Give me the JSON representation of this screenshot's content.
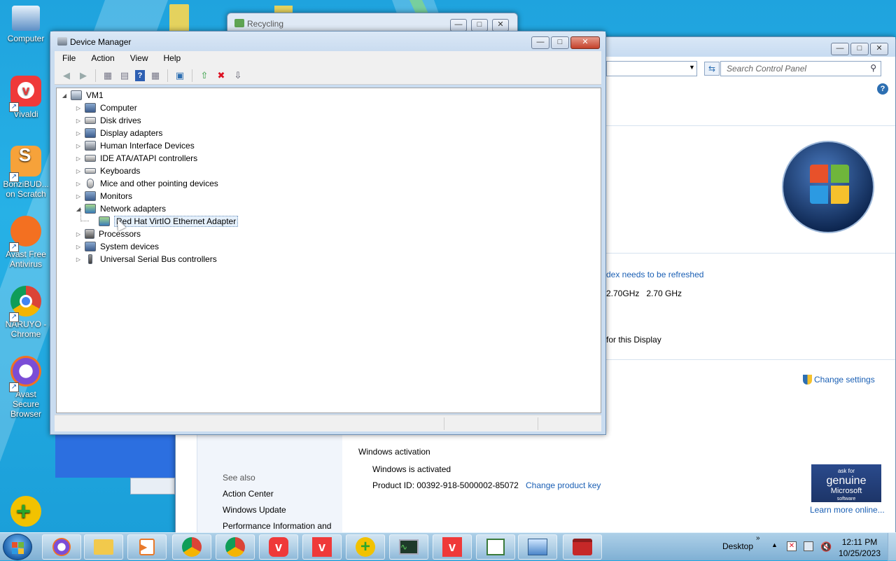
{
  "desktop": {
    "icons": [
      {
        "label": "Computer",
        "icon": "computer-icon"
      },
      {
        "label": "Vivaldi",
        "icon": "vivaldi-icon"
      },
      {
        "label": "BonziBUD... on Scratch",
        "icon": "scratch-icon"
      },
      {
        "label": "Avast Free Antivirus",
        "icon": "avast-icon"
      },
      {
        "label": "NARUYO - Chrome",
        "icon": "chrome-icon"
      },
      {
        "label": "Avast Secure Browser",
        "icon": "avast-secure-browser-icon"
      }
    ]
  },
  "recycling": {
    "title": "Recycling"
  },
  "control_panel": {
    "search_placeholder": "Search Control Panel",
    "index_text": "dex needs to be refreshed",
    "processor_text": "2.70GHz   2.70 GHz",
    "display_text": "for this Display",
    "change_settings": "Change settings",
    "activation_heading": "Windows activation",
    "activated": "Windows is activated",
    "product_id_label": "Product ID: 00392-918-5000002-85072",
    "change_key": "Change product key",
    "genuine_line1": "ask for",
    "genuine_line2": "genuine",
    "genuine_line3": "Microsoft",
    "genuine_line4": "software",
    "learn_more": "Learn more online...",
    "see_also": "See also",
    "see_also_links": [
      "Action Center",
      "Windows Update",
      "Performance Information and"
    ]
  },
  "device_manager": {
    "title": "Device Manager",
    "menu": [
      "File",
      "Action",
      "View",
      "Help"
    ],
    "root": "VM1",
    "categories": [
      {
        "label": "Computer",
        "expanded": false
      },
      {
        "label": "Disk drives",
        "expanded": false
      },
      {
        "label": "Display adapters",
        "expanded": false
      },
      {
        "label": "Human Interface Devices",
        "expanded": false
      },
      {
        "label": "IDE ATA/ATAPI controllers",
        "expanded": false
      },
      {
        "label": "Keyboards",
        "expanded": false
      },
      {
        "label": "Mice and other pointing devices",
        "expanded": false
      },
      {
        "label": "Monitors",
        "expanded": false
      },
      {
        "label": "Network adapters",
        "expanded": true
      },
      {
        "label": "Processors",
        "expanded": false
      },
      {
        "label": "System devices",
        "expanded": false
      },
      {
        "label": "Universal Serial Bus controllers",
        "expanded": false
      }
    ],
    "network_child": "Red Hat VirtIO Ethernet Adapter"
  },
  "taskbar": {
    "desktop_label": "Desktop",
    "time": "12:11 PM",
    "date": "10/25/2023"
  }
}
